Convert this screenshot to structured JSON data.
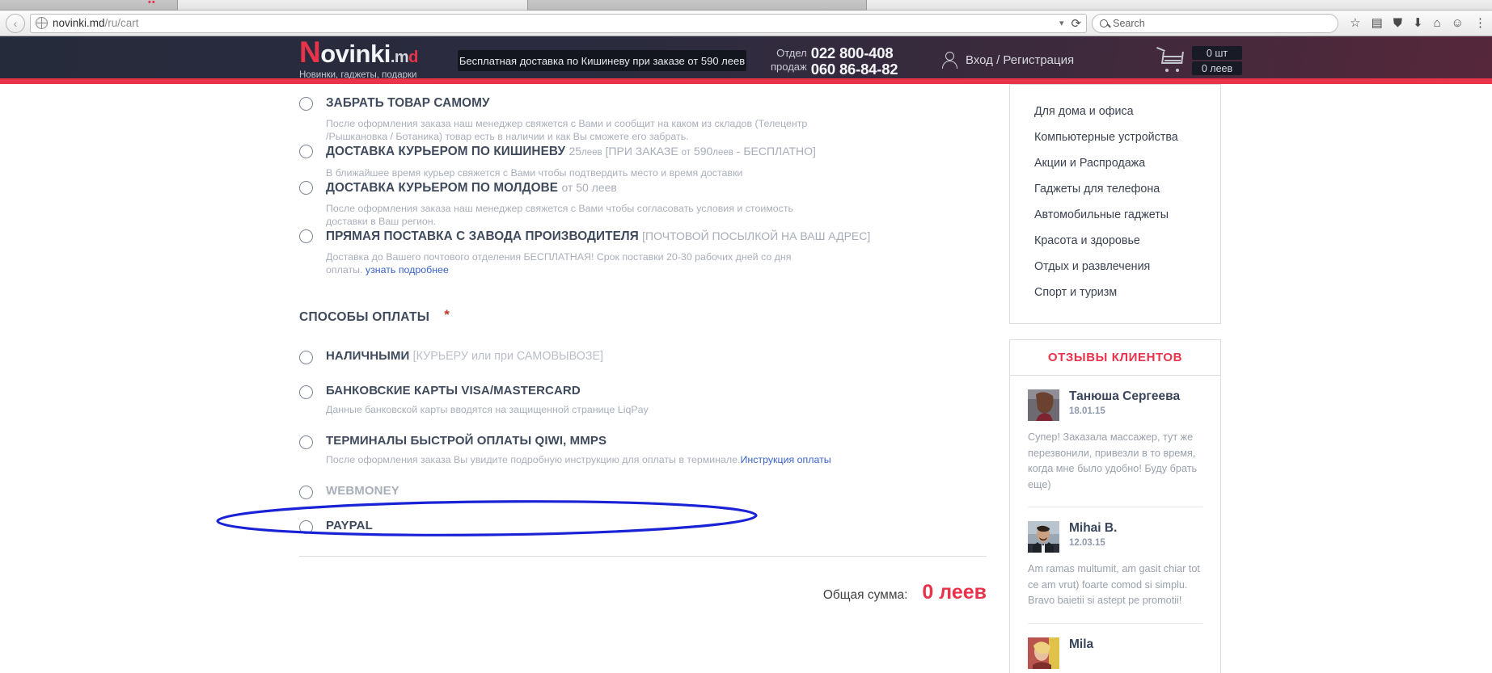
{
  "browser": {
    "back_label": "‹",
    "url_main": "novinki.md",
    "url_path": "/ru/cart",
    "dropdown_icon": "chevron-down-icon",
    "reload_icon": "reload-icon",
    "search_placeholder": "Search",
    "toolbar_icons": [
      "star-icon",
      "reader-list-icon",
      "shield-icon",
      "download-icon",
      "home-icon",
      "smiley-icon",
      "menu-icon"
    ]
  },
  "header": {
    "logo": {
      "first_letter": "N",
      "main": "ovinki",
      "suffix_m": ".m",
      "suffix_d": "d"
    },
    "tagline": "Новинки, гаджеты, подарки",
    "promo": "Бесплатная доставка по Кишиневу при заказе от 590 леев",
    "phone_label_line1": "Отдел",
    "phone_label_line2": "продаж",
    "phone1": "022 800-408",
    "phone2": "060 86-84-82",
    "account": "Вход / Регистрация",
    "cart_qty": "0 шт",
    "cart_sum": "0 леев",
    "accent_red": "#e8334a",
    "bar_dark": "#262b3c"
  },
  "delivery": {
    "options": [
      {
        "title": "ЗАБРАТЬ ТОВАР САМОМУ",
        "desc": "После оформления заказа наш менеджер свяжется с Вами и сообщит на каком из складов (Телецентр /Рышкановка / Ботаника) товар есть в наличии и как Вы сможете его забрать."
      },
      {
        "title": "ДОСТАВКА КУРЬЕРОМ ПО КИШИНЕВУ",
        "price": "25",
        "price_unit": "леев",
        "note_prefix": "[ПРИ ЗАКАЗЕ ",
        "note_small": "от",
        "note_mid": " 590",
        "note_small2": "леев",
        "note_suffix": " - БЕСПЛАТНО]",
        "desc": "В ближайшее время курьер свяжется с Вами чтобы подтвердить место и время доставки"
      },
      {
        "title": "ДОСТАВКА КУРЬЕРОМ ПО МОЛДОВЕ",
        "sub": "от 50 леев",
        "desc": "После оформления заказа наш менеджер свяжется с Вами чтобы согласовать условия и стоимость доставки в Ваш регион."
      },
      {
        "title": "ПРЯМАЯ ПОСТАВКА С ЗАВОДА ПРОИЗВОДИТЕЛЯ",
        "sub": "[ПОЧТОВОЙ ПОСЫЛКОЙ НА ВАШ АДРЕС]",
        "desc": "Доставка до Вашего почтового отделения БЕСПЛАТНАЯ! Срок поставки 20-30 рабочих дней со дня оплаты. ",
        "link": "узнать подробнее"
      }
    ]
  },
  "payment": {
    "heading": "СПОСОБЫ ОПЛАТЫ",
    "required_marker": "*",
    "options": [
      {
        "title": "НАЛИЧНЫМИ",
        "sub": "[КУРЬЕРУ или при САМОВЫВОЗЕ]",
        "desc": ""
      },
      {
        "title": "БАНКОВСКИЕ КАРТЫ VISA/MASTERCARD",
        "sub": "",
        "desc": "Данные банковской карты вводятся на защищенной странице LiqPay"
      },
      {
        "title": "ТЕРМИНАЛЫ БЫСТРОЙ ОПЛАТЫ QIWI, MMPS",
        "sub": "",
        "desc": "После оформления заказа Вы увидите подробную инструкцию для оплаты в терминале.",
        "desc_link": "Инструкция оплаты"
      },
      {
        "title": "WEBMONEY",
        "sub": "",
        "desc": "",
        "muted": true
      },
      {
        "title": "PAYPAL",
        "sub": "",
        "desc": ""
      }
    ]
  },
  "total": {
    "label": "Общая сумма:",
    "value": "0 леев",
    "color": "#e8334a"
  },
  "annotation": {
    "type": "hand-drawn-ellipse",
    "color": "#1a22d6",
    "targets": "ТЕРМИНАЛЫ БЫСТРОЙ ОПЛАТЫ QIWI, MMPS"
  },
  "sidebar": {
    "categories": [
      "Для дома и офиса",
      "Компьютерные устройства",
      "Акции и Распродажа",
      "Гаджеты для телефона",
      "Автомобильные гаджеты",
      "Красота и здоровье",
      "Отдых и развлечения",
      "Спорт и туризм"
    ],
    "reviews_title": "ОТЗЫВЫ КЛИЕНТОВ",
    "reviews": [
      {
        "name": "Танюша Сергеева",
        "date": "18.01.15",
        "text": "Супер! Заказала массажер, тут же перезвонили, привезли в то время, когда мне было удобно! Буду брать еще)"
      },
      {
        "name": "Mihai B.",
        "date": "12.03.15",
        "text": "Am ramas multumit, am gasit chiar tot ce am vrut) foarte comod si simplu. Bravo baietii si astept pe promotii!"
      },
      {
        "name": "Mila",
        "date": "",
        "text": ""
      }
    ]
  }
}
